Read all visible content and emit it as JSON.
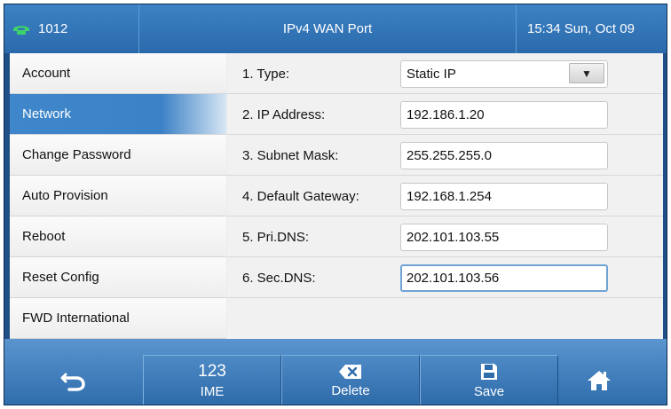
{
  "status_bar": {
    "account": "1012",
    "title": "IPv4 WAN Port",
    "clock": "15:34 Sun, Oct 09"
  },
  "sidebar": {
    "items": [
      {
        "label": "Account"
      },
      {
        "label": "Network",
        "active": true
      },
      {
        "label": "Change Password"
      },
      {
        "label": "Auto Provision"
      },
      {
        "label": "Reboot"
      },
      {
        "label": "Reset Config"
      },
      {
        "label": "FWD International"
      }
    ]
  },
  "form": {
    "rows": [
      {
        "label": "1. Type:",
        "value": "Static IP",
        "kind": "select"
      },
      {
        "label": "2. IP Address:",
        "value": "192.186.1.20"
      },
      {
        "label": "3. Subnet Mask:",
        "value": "255.255.255.0"
      },
      {
        "label": "4. Default Gateway:",
        "value": "192.168.1.254"
      },
      {
        "label": "5. Pri.DNS:",
        "value": "202.101.103.55"
      },
      {
        "label": "6. Sec.DNS:",
        "value": "202.101.103.56",
        "focused": true
      }
    ]
  },
  "softkeys": {
    "back_icon": "back-arrow-icon",
    "ime_value": "123",
    "ime_label": "IME",
    "delete_icon": "backspace-icon",
    "delete_label": "Delete",
    "save_icon": "floppy-disk-icon",
    "save_label": "Save",
    "home_icon": "home-icon"
  },
  "colors": {
    "accent": "#3f86cb",
    "bar": "#2a6aab"
  }
}
